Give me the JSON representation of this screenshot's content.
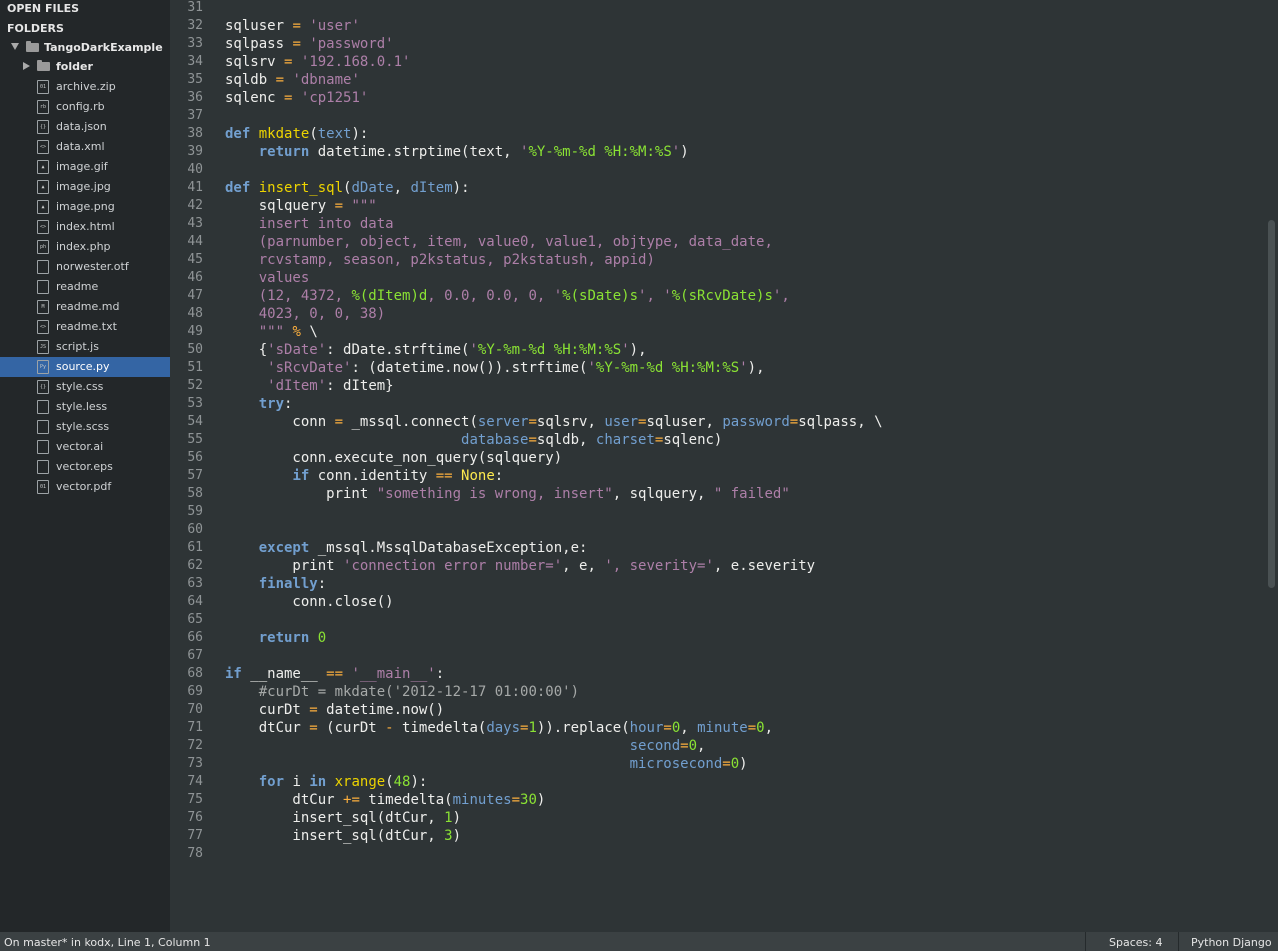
{
  "sidebar": {
    "open_files_label": "OPEN FILES",
    "folders_label": "FOLDERS",
    "project_name": "TangoDarkExample",
    "subfolder_name": "folder",
    "files": [
      {
        "name": "archive.zip",
        "icon": "zip-file-icon",
        "glyph": "01"
      },
      {
        "name": "config.rb",
        "icon": "ruby-file-icon",
        "glyph": "rb"
      },
      {
        "name": "data.json",
        "icon": "json-file-icon",
        "glyph": "{}"
      },
      {
        "name": "data.xml",
        "icon": "xml-file-icon",
        "glyph": "<>"
      },
      {
        "name": "image.gif",
        "icon": "image-file-icon",
        "glyph": "▲"
      },
      {
        "name": "image.jpg",
        "icon": "image-file-icon",
        "glyph": "▲"
      },
      {
        "name": "image.png",
        "icon": "image-file-icon",
        "glyph": "▲"
      },
      {
        "name": "index.html",
        "icon": "html-file-icon",
        "glyph": "<>"
      },
      {
        "name": "index.php",
        "icon": "php-file-icon",
        "glyph": "ph"
      },
      {
        "name": "norwester.otf",
        "icon": "file-icon",
        "glyph": ""
      },
      {
        "name": "readme",
        "icon": "file-icon",
        "glyph": ""
      },
      {
        "name": "readme.md",
        "icon": "markdown-file-icon",
        "glyph": "M"
      },
      {
        "name": "readme.txt",
        "icon": "text-file-icon",
        "glyph": "<>"
      },
      {
        "name": "script.js",
        "icon": "js-file-icon",
        "glyph": "JS"
      },
      {
        "name": "source.py",
        "icon": "python-file-icon",
        "glyph": "Py",
        "selected": true
      },
      {
        "name": "style.css",
        "icon": "css-file-icon",
        "glyph": "{}"
      },
      {
        "name": "style.less",
        "icon": "file-icon",
        "glyph": ""
      },
      {
        "name": "style.scss",
        "icon": "file-icon",
        "glyph": ""
      },
      {
        "name": "vector.ai",
        "icon": "file-icon",
        "glyph": ""
      },
      {
        "name": "vector.eps",
        "icon": "file-icon",
        "glyph": ""
      },
      {
        "name": "vector.pdf",
        "icon": "pdf-file-icon",
        "glyph": "01"
      }
    ]
  },
  "editor": {
    "first_line": 31,
    "lines": [
      [],
      [
        [
          "",
          "sqluser "
        ],
        [
          "op",
          "="
        ],
        [
          "",
          " "
        ],
        [
          "str",
          "'user'"
        ]
      ],
      [
        [
          "",
          "sqlpass "
        ],
        [
          "op",
          "="
        ],
        [
          "",
          " "
        ],
        [
          "str",
          "'password'"
        ]
      ],
      [
        [
          "",
          "sqlsrv "
        ],
        [
          "op",
          "="
        ],
        [
          "",
          " "
        ],
        [
          "str",
          "'192.168.0.1'"
        ]
      ],
      [
        [
          "",
          "sqldb "
        ],
        [
          "op",
          "="
        ],
        [
          "",
          " "
        ],
        [
          "str",
          "'dbname'"
        ]
      ],
      [
        [
          "",
          "sqlenc "
        ],
        [
          "op",
          "="
        ],
        [
          "",
          " "
        ],
        [
          "str",
          "'cp1251'"
        ]
      ],
      [],
      [
        [
          "kw",
          "def"
        ],
        [
          "",
          " "
        ],
        [
          "fn",
          "mkdate"
        ],
        [
          "",
          "("
        ],
        [
          "pm",
          "text"
        ],
        [
          "",
          "):"
        ]
      ],
      [
        [
          "",
          "    "
        ],
        [
          "kw",
          "return"
        ],
        [
          "",
          " datetime.strptime(text, "
        ],
        [
          "str",
          "'"
        ],
        [
          "strm",
          "%Y-%m-%d %H:%M:%S"
        ],
        [
          "str",
          "'"
        ],
        [
          "",
          ")"
        ]
      ],
      [],
      [
        [
          "kw",
          "def"
        ],
        [
          "",
          " "
        ],
        [
          "fn",
          "insert_sql"
        ],
        [
          "",
          "("
        ],
        [
          "pm",
          "dDate"
        ],
        [
          "",
          ", "
        ],
        [
          "pm",
          "dItem"
        ],
        [
          "",
          "):"
        ]
      ],
      [
        [
          "",
          "    sqlquery "
        ],
        [
          "op",
          "="
        ],
        [
          "",
          " "
        ],
        [
          "str",
          "\"\"\""
        ]
      ],
      [
        [
          "",
          "    "
        ],
        [
          "str",
          "insert into data"
        ]
      ],
      [
        [
          "",
          "    "
        ],
        [
          "str",
          "(parnumber, object, item, value0, value1, objtype, data_date,"
        ]
      ],
      [
        [
          "",
          "    "
        ],
        [
          "str",
          "rcvstamp, season, p2kstatus, p2kstatush, appid)"
        ]
      ],
      [
        [
          "",
          "    "
        ],
        [
          "str",
          "values"
        ]
      ],
      [
        [
          "",
          "    "
        ],
        [
          "str",
          "(12, 4372, "
        ],
        [
          "strm",
          "%(dItem)d"
        ],
        [
          "str",
          ", 0.0, 0.0, 0, '"
        ],
        [
          "strm",
          "%(sDate)s"
        ],
        [
          "str",
          "', '"
        ],
        [
          "strm",
          "%(sRcvDate)s"
        ],
        [
          "str",
          "',"
        ]
      ],
      [
        [
          "",
          "    "
        ],
        [
          "str",
          "4023, 0, 0, 38)"
        ]
      ],
      [
        [
          "",
          "    "
        ],
        [
          "str",
          "\"\"\""
        ],
        [
          "",
          " "
        ],
        [
          "op",
          "%"
        ],
        [
          "",
          " \\"
        ]
      ],
      [
        [
          "",
          "    {"
        ],
        [
          "str",
          "'sDate'"
        ],
        [
          "",
          ": dDate.strftime("
        ],
        [
          "str",
          "'"
        ],
        [
          "strm",
          "%Y-%m-%d %H:%M:%S"
        ],
        [
          "str",
          "'"
        ],
        [
          "",
          "),"
        ]
      ],
      [
        [
          "",
          "     "
        ],
        [
          "str",
          "'sRcvDate'"
        ],
        [
          "",
          ": (datetime.now()).strftime("
        ],
        [
          "str",
          "'"
        ],
        [
          "strm",
          "%Y-%m-%d %H:%M:%S"
        ],
        [
          "str",
          "'"
        ],
        [
          "",
          "),"
        ]
      ],
      [
        [
          "",
          "     "
        ],
        [
          "str",
          "'dItem'"
        ],
        [
          "",
          ": dItem}"
        ]
      ],
      [
        [
          "",
          "    "
        ],
        [
          "kw",
          "try"
        ],
        [
          "",
          ":"
        ]
      ],
      [
        [
          "",
          "        conn "
        ],
        [
          "op",
          "="
        ],
        [
          "",
          " _mssql.connect("
        ],
        [
          "pm",
          "server"
        ],
        [
          "op",
          "="
        ],
        [
          "",
          "sqlsrv, "
        ],
        [
          "pm",
          "user"
        ],
        [
          "op",
          "="
        ],
        [
          "",
          "sqluser, "
        ],
        [
          "pm",
          "password"
        ],
        [
          "op",
          "="
        ],
        [
          "",
          "sqlpass, \\"
        ]
      ],
      [
        [
          "",
          "                            "
        ],
        [
          "pm",
          "database"
        ],
        [
          "op",
          "="
        ],
        [
          "",
          "sqldb, "
        ],
        [
          "pm",
          "charset"
        ],
        [
          "op",
          "="
        ],
        [
          "",
          "sqlenc)"
        ]
      ],
      [
        [
          "",
          "        conn.execute_non_query(sqlquery)"
        ]
      ],
      [
        [
          "",
          "        "
        ],
        [
          "kw",
          "if"
        ],
        [
          "",
          " conn.identity "
        ],
        [
          "op",
          "=="
        ],
        [
          "",
          " "
        ],
        [
          "bi",
          "None"
        ],
        [
          "",
          ":"
        ]
      ],
      [
        [
          "",
          "            print "
        ],
        [
          "str",
          "\"something is wrong, insert\""
        ],
        [
          "",
          ", sqlquery, "
        ],
        [
          "str",
          "\" failed\""
        ]
      ],
      [],
      [],
      [
        [
          "",
          "    "
        ],
        [
          "kw",
          "except"
        ],
        [
          "",
          " _mssql.MssqlDatabaseException,e:"
        ]
      ],
      [
        [
          "",
          "        print "
        ],
        [
          "str",
          "'connection error number='"
        ],
        [
          "",
          ", e, "
        ],
        [
          "str",
          "', severity='"
        ],
        [
          "",
          ", e.severity"
        ]
      ],
      [
        [
          "",
          "    "
        ],
        [
          "kw",
          "finally"
        ],
        [
          "",
          ":"
        ]
      ],
      [
        [
          "",
          "        conn.close()"
        ]
      ],
      [],
      [
        [
          "",
          "    "
        ],
        [
          "kw",
          "return"
        ],
        [
          "",
          " "
        ],
        [
          "num",
          "0"
        ]
      ],
      [],
      [
        [
          "kw",
          "if"
        ],
        [
          "",
          " __name__ "
        ],
        [
          "op",
          "=="
        ],
        [
          "",
          " "
        ],
        [
          "str",
          "'__main__'"
        ],
        [
          "",
          ":"
        ]
      ],
      [
        [
          "",
          "    "
        ],
        [
          "cm",
          "#curDt = mkdate('2012-12-17 01:00:00')"
        ]
      ],
      [
        [
          "",
          "    curDt "
        ],
        [
          "op",
          "="
        ],
        [
          "",
          " datetime.now()"
        ]
      ],
      [
        [
          "",
          "    dtCur "
        ],
        [
          "op",
          "="
        ],
        [
          "",
          " (curDt "
        ],
        [
          "op",
          "-"
        ],
        [
          "",
          " timedelta("
        ],
        [
          "pm",
          "days"
        ],
        [
          "op",
          "="
        ],
        [
          "num",
          "1"
        ],
        [
          "",
          "))."
        ],
        [
          "",
          "replace("
        ],
        [
          "pm",
          "hour"
        ],
        [
          "op",
          "="
        ],
        [
          "num",
          "0"
        ],
        [
          "",
          ", "
        ],
        [
          "pm",
          "minute"
        ],
        [
          "op",
          "="
        ],
        [
          "num",
          "0"
        ],
        [
          "",
          ","
        ]
      ],
      [
        [
          "",
          "                                                "
        ],
        [
          "pm",
          "second"
        ],
        [
          "op",
          "="
        ],
        [
          "num",
          "0"
        ],
        [
          "",
          ","
        ]
      ],
      [
        [
          "",
          "                                                "
        ],
        [
          "pm",
          "microsecond"
        ],
        [
          "op",
          "="
        ],
        [
          "num",
          "0"
        ],
        [
          "",
          ")"
        ]
      ],
      [
        [
          "",
          "    "
        ],
        [
          "kw",
          "for"
        ],
        [
          "",
          " i "
        ],
        [
          "kw",
          "in"
        ],
        [
          "",
          " "
        ],
        [
          "fn",
          "xrange"
        ],
        [
          "",
          "("
        ],
        [
          "num",
          "48"
        ],
        [
          "",
          "):"
        ]
      ],
      [
        [
          "",
          "        dtCur "
        ],
        [
          "op",
          "+="
        ],
        [
          "",
          " timedelta("
        ],
        [
          "pm",
          "minutes"
        ],
        [
          "op",
          "="
        ],
        [
          "num",
          "30"
        ],
        [
          "",
          ")"
        ]
      ],
      [
        [
          "",
          "        insert_sql(dtCur, "
        ],
        [
          "num",
          "1"
        ],
        [
          "",
          ")"
        ]
      ],
      [
        [
          "",
          "        insert_sql(dtCur, "
        ],
        [
          "num",
          "3"
        ],
        [
          "",
          ")"
        ]
      ],
      []
    ]
  },
  "statusbar": {
    "position_text": "On master* in kodx, Line 1, Column 1",
    "indent_text": "Spaces: 4",
    "syntax_text": "Python Django"
  },
  "colors": {
    "sidebar_bg": "#232729",
    "editor_bg": "#2e3436",
    "selection": "#3465a4",
    "keyword": "#729fcf",
    "string": "#ad7fa8",
    "function": "#edd400",
    "number": "#8ae234"
  }
}
